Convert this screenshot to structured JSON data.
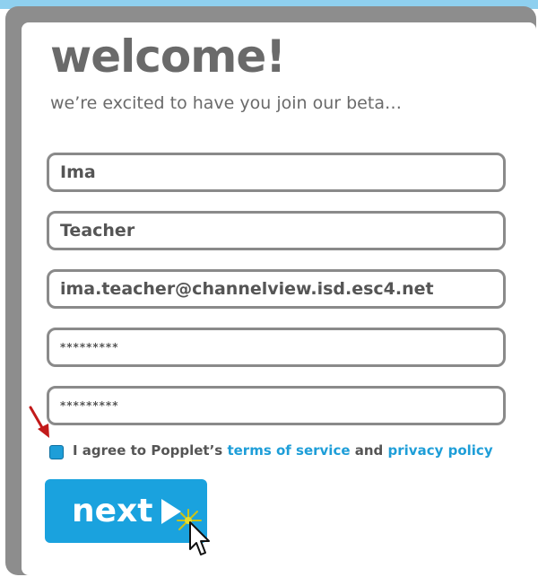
{
  "title": "welcome!",
  "subtitle": "we’re excited to have you join our beta…",
  "form": {
    "first_name": "Ima",
    "last_name": "Teacher",
    "email": "ima.teacher@channelview.isd.esc4.net",
    "password": "*********",
    "confirm_password": "*********"
  },
  "agreement": {
    "prefix": "I agree to Popplet’s",
    "terms_link": "terms of service",
    "and": "and",
    "privacy_link": "privacy policy",
    "checked": true
  },
  "next_button": {
    "label": "next"
  },
  "colors": {
    "accent": "#1aa2de",
    "text_gray": "#6a6a6a",
    "frame_gray": "#8d8d8d",
    "arrow_red": "#c21a1a"
  },
  "icons": [
    "red-arrow-icon",
    "play-triangle-icon",
    "cursor-click-icon"
  ]
}
